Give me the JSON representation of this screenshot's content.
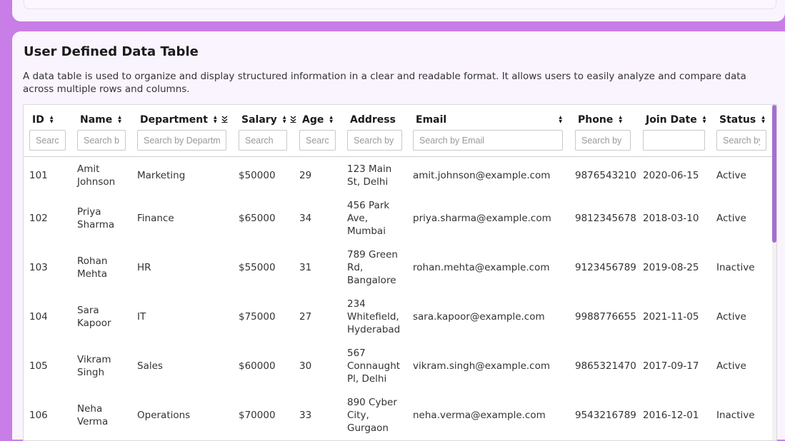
{
  "page": {
    "title": "User Defined Data Table",
    "description": "A data table is used to organize and display structured information in a clear and readable format. It allows users to easily analyze and compare data across multiple rows and columns."
  },
  "columns": [
    {
      "key": "id",
      "label": "ID",
      "placeholder": "Search by ID",
      "sort": true,
      "filter": false
    },
    {
      "key": "name",
      "label": "Name",
      "placeholder": "Search by Name",
      "sort": true,
      "filter": false
    },
    {
      "key": "department",
      "label": "Department",
      "placeholder": "Search by Department",
      "sort": true,
      "filter": true
    },
    {
      "key": "salary",
      "label": "Salary",
      "placeholder": "Search",
      "sort": true,
      "filter": true
    },
    {
      "key": "age",
      "label": "Age",
      "placeholder": "Search",
      "sort": true,
      "filter": false
    },
    {
      "key": "address",
      "label": "Address",
      "placeholder": "Search by Address",
      "sort": false,
      "filter": false
    },
    {
      "key": "email",
      "label": "Email",
      "placeholder": "Search by Email",
      "sort": true,
      "filter": false
    },
    {
      "key": "phone",
      "label": "Phone",
      "placeholder": "Search by Phone",
      "sort": true,
      "filter": false
    },
    {
      "key": "join_date",
      "label": "Join Date",
      "placeholder": "",
      "sort": true,
      "filter": false
    },
    {
      "key": "status",
      "label": "Status",
      "placeholder": "Search by Status",
      "sort": true,
      "filter": false
    }
  ],
  "rows": [
    {
      "id": "101",
      "name": "Amit Johnson",
      "department": "Marketing",
      "salary": "$50000",
      "age": "29",
      "address": "123 Main St, Delhi",
      "email": "amit.johnson@example.com",
      "phone": "9876543210",
      "join_date": "2020-06-15",
      "status": "Active"
    },
    {
      "id": "102",
      "name": "Priya Sharma",
      "department": "Finance",
      "salary": "$65000",
      "age": "34",
      "address": "456 Park Ave, Mumbai",
      "email": "priya.sharma@example.com",
      "phone": "9812345678",
      "join_date": "2018-03-10",
      "status": "Active"
    },
    {
      "id": "103",
      "name": "Rohan Mehta",
      "department": "HR",
      "salary": "$55000",
      "age": "31",
      "address": "789 Green Rd, Bangalore",
      "email": "rohan.mehta@example.com",
      "phone": "9123456789",
      "join_date": "2019-08-25",
      "status": "Inactive"
    },
    {
      "id": "104",
      "name": "Sara Kapoor",
      "department": "IT",
      "salary": "$75000",
      "age": "27",
      "address": "234 Whitefield, Hyderabad",
      "email": "sara.kapoor@example.com",
      "phone": "9988776655",
      "join_date": "2021-11-05",
      "status": "Active"
    },
    {
      "id": "105",
      "name": "Vikram Singh",
      "department": "Sales",
      "salary": "$60000",
      "age": "30",
      "address": "567 Connaught Pl, Delhi",
      "email": "vikram.singh@example.com",
      "phone": "9865321470",
      "join_date": "2017-09-17",
      "status": "Active"
    },
    {
      "id": "106",
      "name": "Neha Verma",
      "department": "Operations",
      "salary": "$70000",
      "age": "33",
      "address": "890 Cyber City, Gurgaon",
      "email": "neha.verma@example.com",
      "phone": "9543216789",
      "join_date": "2016-12-01",
      "status": "Inactive"
    }
  ],
  "icons": {
    "sort": "sort-icon",
    "filter": "filter-icon"
  },
  "colors": {
    "background": "#c97de6",
    "card": "#faf4ff",
    "scrollbar": "#a66fd0"
  }
}
